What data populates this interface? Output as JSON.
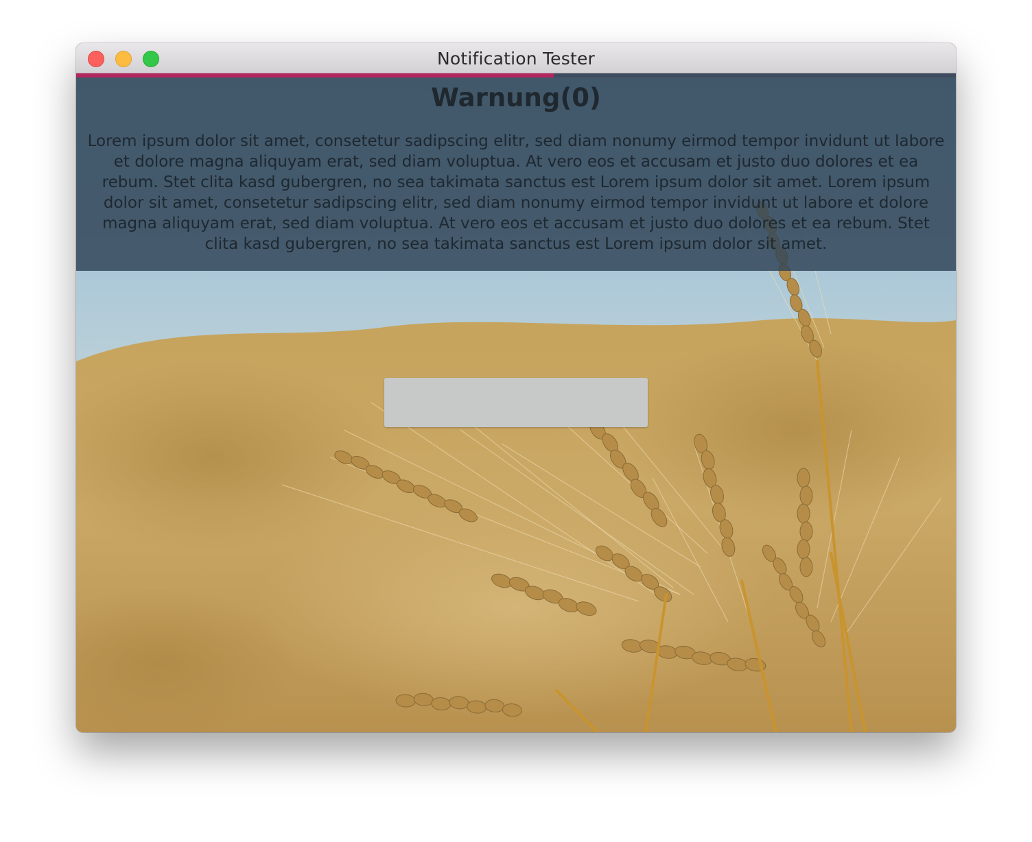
{
  "window": {
    "title": "Notification Tester"
  },
  "notification": {
    "title": "Warnung(0)",
    "body": "Lorem ipsum dolor sit amet, consetetur sadipscing elitr, sed diam nonumy eirmod tempor invidunt ut labore et dolore magna aliquyam erat, sed diam voluptua. At vero eos et accusam et justo duo dolores et ea rebum. Stet clita kasd gubergren, no sea takimata sanctus est Lorem ipsum dolor sit amet. Lorem ipsum dolor sit amet, consetetur sadipscing elitr, sed diam nonumy eirmod tempor invidunt ut labore et dolore magna aliquyam erat, sed diam voluptua. At vero eos et accusam et justo duo dolores et ea rebum. Stet clita kasd gubergren, no sea takimata sanctus est Lorem ipsum dolor sit amet.",
    "progress_fraction": 0.543,
    "progress_color": "#b3265f",
    "panel_color": "#34485a"
  },
  "action_button": {
    "label": ""
  },
  "background": {
    "subject": "wheat field"
  }
}
